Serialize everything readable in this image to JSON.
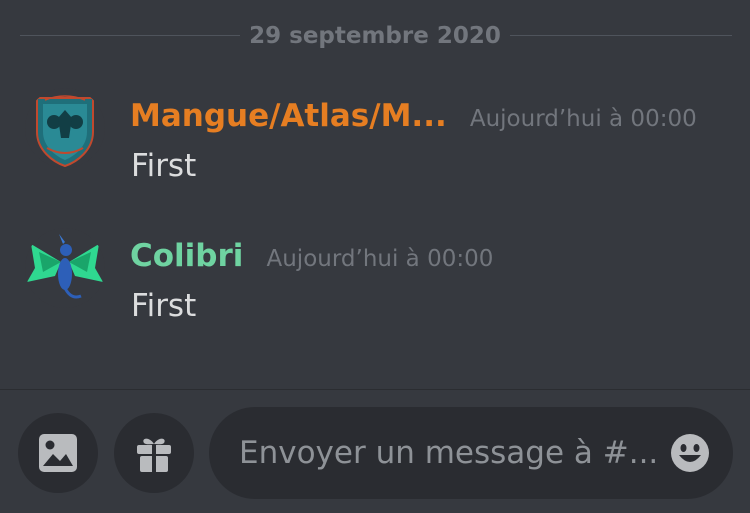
{
  "channel": {
    "date_divider": "29 septembre 2020"
  },
  "messages": [
    {
      "author": "Mangue/Atlas/M...",
      "author_color": "#e67e22",
      "timestamp": "Aujourd’hui à 00:00",
      "content": "First",
      "avatar_icon": "wolf-emblem-avatar"
    },
    {
      "author": "Colibri",
      "author_color": "#6fd3a1",
      "timestamp": "Aujourd’hui à 00:00",
      "content": "First",
      "avatar_icon": "dragon-avatar"
    }
  ],
  "composer": {
    "placeholder": "Envoyer un message à #...",
    "image_icon": "image-icon",
    "gift_icon": "gift-icon",
    "emoji_icon": "emoji-icon"
  },
  "colors": {
    "background": "#36393f",
    "input_background": "#2a2c31",
    "muted_text": "#72767d",
    "body_text": "#dcddde"
  }
}
